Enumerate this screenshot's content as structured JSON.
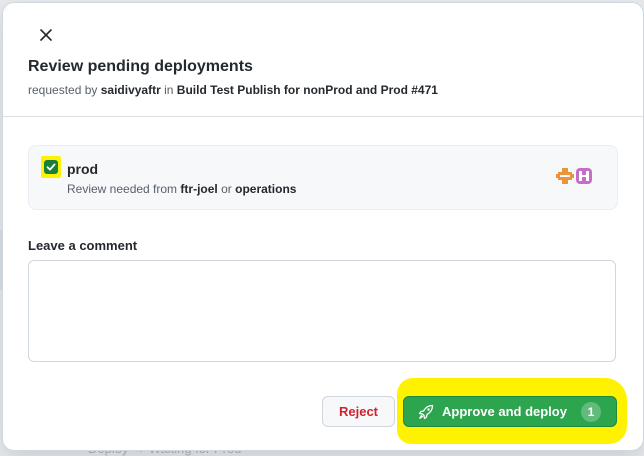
{
  "background": {
    "peek_text": "Deploy → Waiting for Prod"
  },
  "dialog": {
    "title": "Review pending deployments",
    "subtitle": {
      "prefix": "requested by",
      "user": "saidivyaftr",
      "middle": "in",
      "workflow": "Build Test Publish for nonProd and Prod #471"
    },
    "close_icon": "close-icon"
  },
  "environment": {
    "name": "prod",
    "checked": true,
    "review_prefix": "Review needed from",
    "reviewer_1": "ftr-joel",
    "review_or": "or",
    "reviewer_2": "operations",
    "avatar_colors": [
      "#e8953c",
      "#c56ec8"
    ]
  },
  "comment": {
    "label": "Leave a comment",
    "value": "",
    "placeholder": ""
  },
  "actions": {
    "reject_label": "Reject",
    "approve_label": "Approve and deploy",
    "approve_count": "1",
    "approve_icon": "rocket-icon"
  },
  "colors": {
    "approve_bg": "#2da44e",
    "reject_text": "#cf222e",
    "highlight": "#fff200",
    "checkbox": "#1a7f37"
  }
}
